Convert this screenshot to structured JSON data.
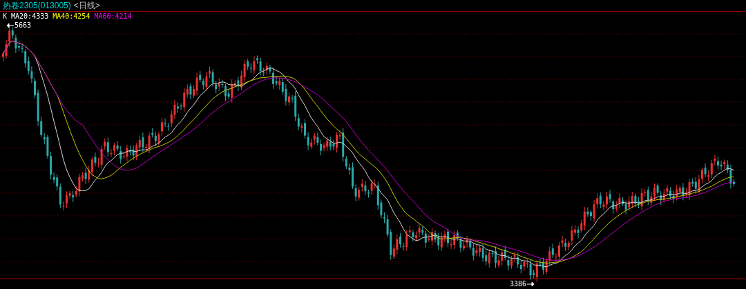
{
  "header": {
    "title": "热卷2305(013005)",
    "period": "<日线>"
  },
  "legend": [
    {
      "label": "K"
    },
    {
      "label": "MA20:4333",
      "color": "#ffffff"
    },
    {
      "label": "MA40:4254",
      "color": "#ffff00"
    },
    {
      "label": "MA60:4214",
      "color": "#ff00ff"
    }
  ],
  "chart": {
    "high_label": "5663",
    "low_label": "3386"
  }
}
